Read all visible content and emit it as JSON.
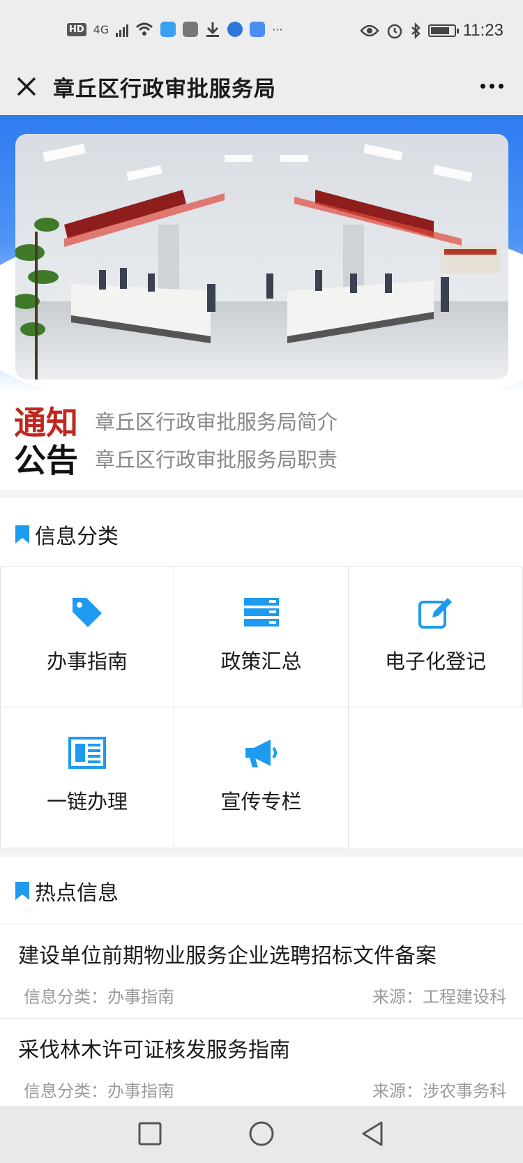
{
  "status_bar": {
    "hd": "HD",
    "network": "4G",
    "time": "11:23",
    "more": "···"
  },
  "nav": {
    "title": "章丘区行政审批服务局"
  },
  "notice": {
    "logo_line1": "通知",
    "logo_line2": "公告",
    "links": [
      "章丘区行政审批服务局简介",
      "章丘区行政审批服务局职责"
    ]
  },
  "info_section": {
    "title": "信息分类",
    "items": [
      {
        "label": "办事指南",
        "icon": "tag-icon"
      },
      {
        "label": "政策汇总",
        "icon": "server-list-icon"
      },
      {
        "label": "电子化登记",
        "icon": "edit-icon"
      },
      {
        "label": "一链办理",
        "icon": "newspaper-icon"
      },
      {
        "label": "宣传专栏",
        "icon": "megaphone-icon"
      }
    ]
  },
  "hot_section": {
    "title": "热点信息",
    "items": [
      {
        "title": "建设单位前期物业服务企业选聘招标文件备案",
        "category": "信息分类：办事指南",
        "source": "来源：工程建设科"
      },
      {
        "title": "采伐林木许可证核发服务指南",
        "category": "信息分类：办事指南",
        "source": "来源：涉农事务科"
      }
    ]
  },
  "colors": {
    "accent": "#1e9bf0",
    "banner_blue": "#2d7cf0",
    "notice_red": "#c0271e"
  }
}
